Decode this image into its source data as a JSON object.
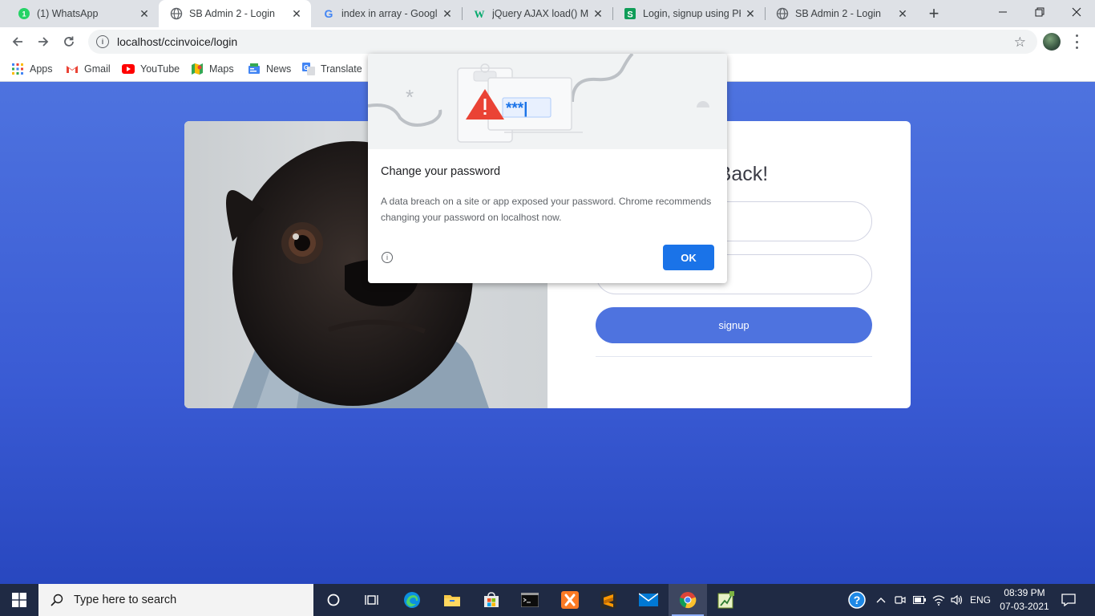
{
  "tabs": [
    {
      "title": "(1) WhatsApp",
      "icon": "whatsapp-icon"
    },
    {
      "title": "SB Admin 2 - Login",
      "icon": "globe-icon"
    },
    {
      "title": "index in array - Google",
      "icon": "google-icon"
    },
    {
      "title": "jQuery AJAX load() Met",
      "icon": "w3schools-icon"
    },
    {
      "title": "Login, signup using PH",
      "icon": "s-site-icon"
    },
    {
      "title": "SB Admin 2 - Login",
      "icon": "globe-icon"
    }
  ],
  "active_tab": 1,
  "toolbar": {
    "url": "localhost/ccinvoice/login"
  },
  "bookmarks": [
    {
      "label": "Apps",
      "icon": "apps-grid-icon"
    },
    {
      "label": "Gmail",
      "icon": "gmail-icon"
    },
    {
      "label": "YouTube",
      "icon": "youtube-icon"
    },
    {
      "label": "Maps",
      "icon": "maps-icon"
    },
    {
      "label": "News",
      "icon": "news-icon"
    },
    {
      "label": "Translate",
      "icon": "translate-icon"
    }
  ],
  "page": {
    "heading_visible": "me Back!",
    "signup_label": "signup"
  },
  "dialog": {
    "title": "Change your password",
    "body": "A data breach on a site or app exposed your password. Chrome recommends changing your password on localhost now.",
    "ok_label": "OK",
    "password_mask": "***|"
  },
  "taskbar": {
    "search_placeholder": "Type here to search",
    "language": "ENG",
    "time": "08:39 PM",
    "date": "07-03-2021"
  },
  "colors": {
    "page_bg": "#4e73df",
    "primary": "#4e73df",
    "chrome_blue": "#1a73e8",
    "taskbar": "#1f2a44"
  }
}
